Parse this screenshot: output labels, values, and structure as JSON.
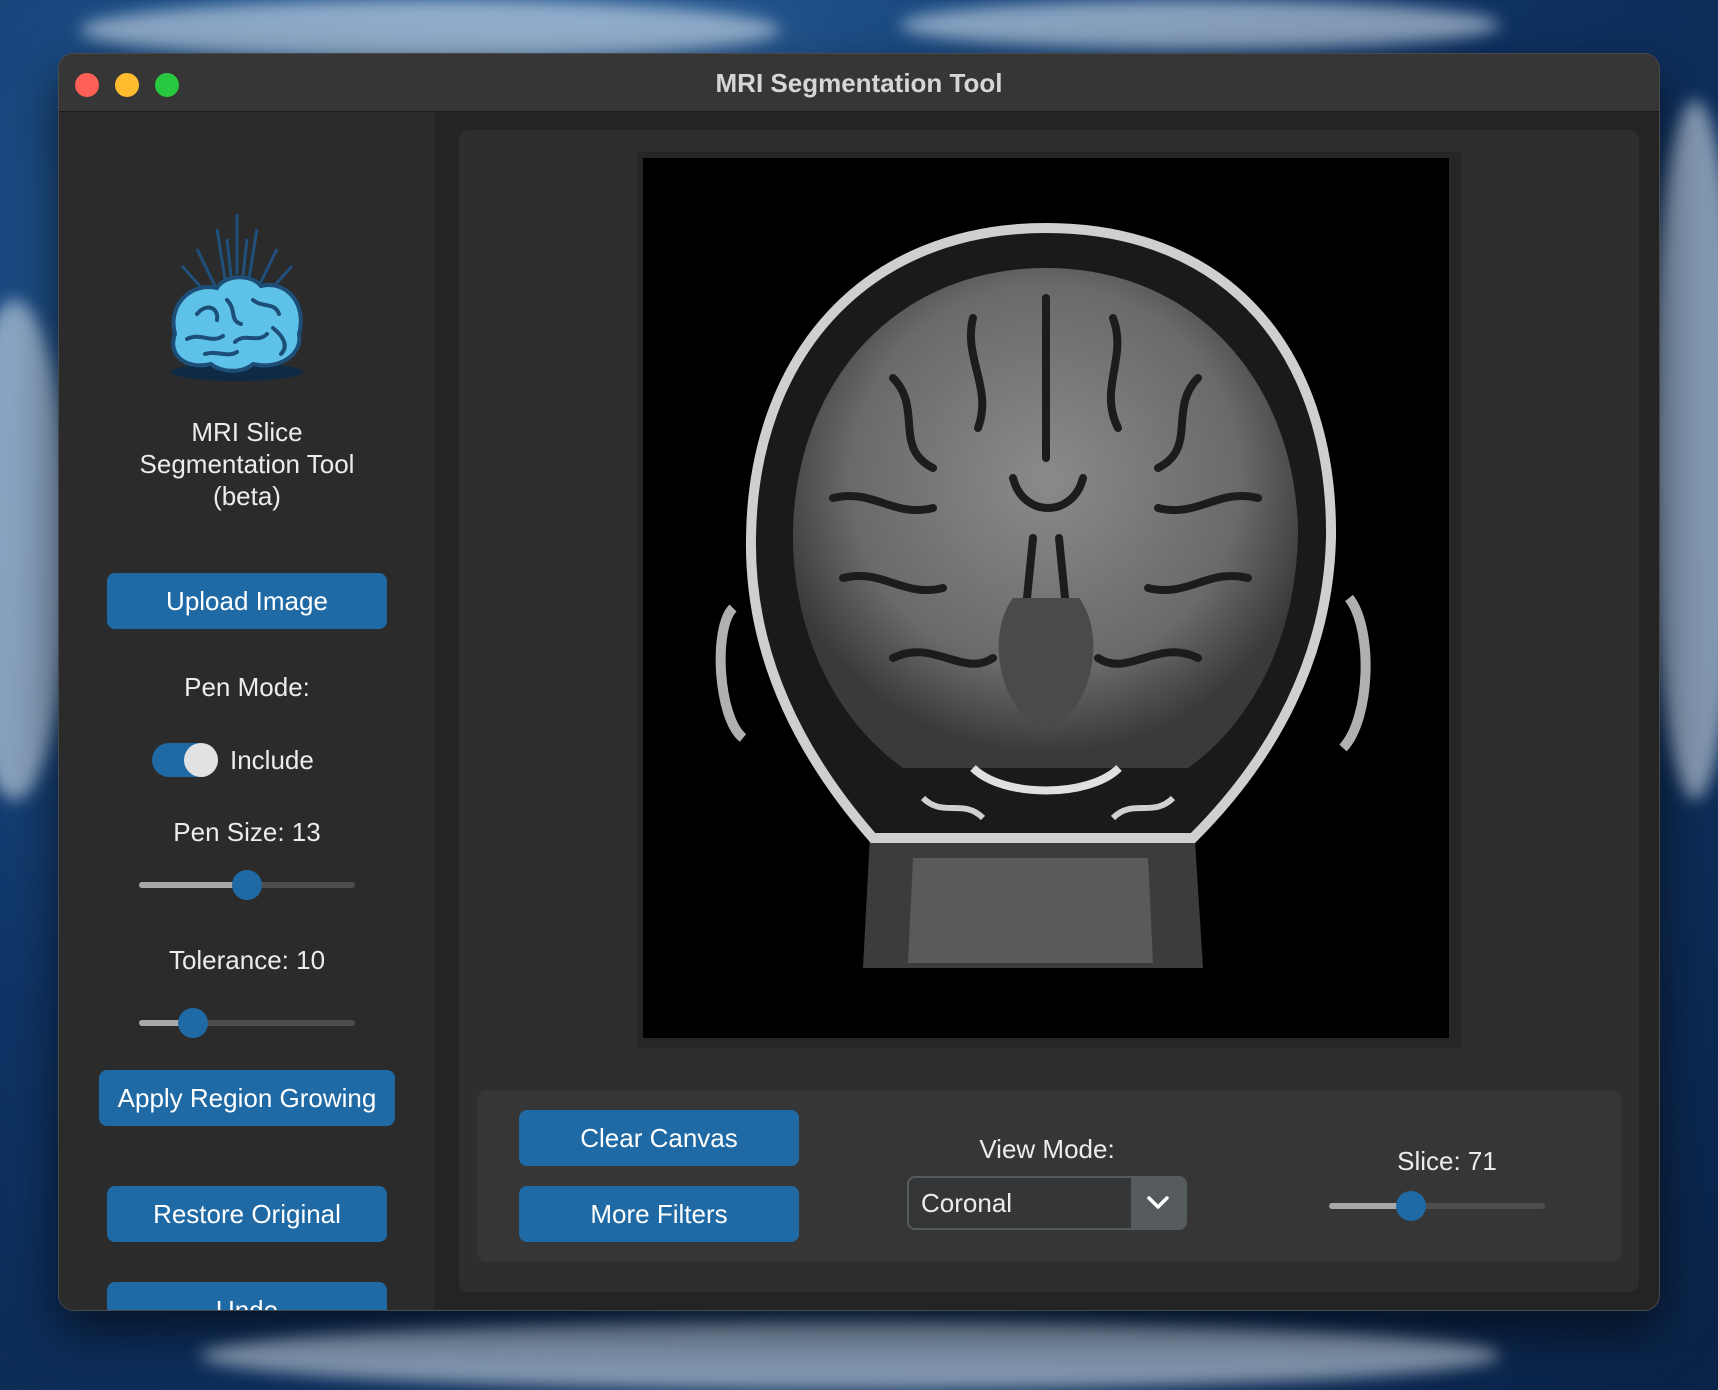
{
  "window": {
    "title": "MRI Segmentation Tool"
  },
  "sidebar": {
    "app_title_line1": "MRI Slice",
    "app_title_line2": "Segmentation Tool",
    "app_title_line3": "(beta)",
    "upload_label": "Upload Image",
    "pen_mode_label": "Pen Mode:",
    "pen_mode_value": "Include",
    "pen_mode_on": true,
    "pen_size_label": "Pen Size: 13",
    "pen_size_fraction": 0.5,
    "tolerance_label": "Tolerance: 10",
    "tolerance_fraction": 0.25,
    "apply_label": "Apply Region Growing",
    "restore_label": "Restore Original",
    "undo_label": "Undo"
  },
  "controls": {
    "clear_label": "Clear Canvas",
    "filters_label": "More Filters",
    "view_mode_label": "View Mode:",
    "view_mode_value": "Coronal",
    "slice_label": "Slice: 71",
    "slice_fraction": 0.38
  },
  "colors": {
    "accent": "#1f6aa5",
    "traffic_red": "#fe5f57",
    "traffic_yellow": "#febc2e",
    "traffic_green": "#28c840"
  }
}
